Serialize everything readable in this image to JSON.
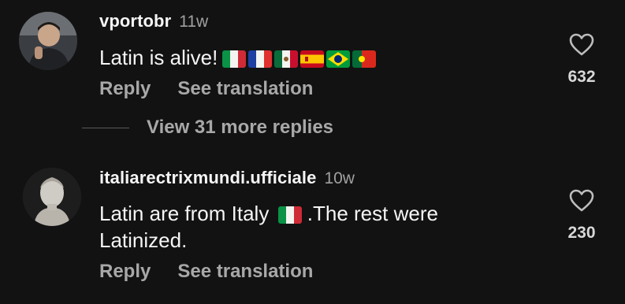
{
  "comments": [
    {
      "username": "vportobr",
      "age": "11w",
      "text": "Latin is alive!",
      "flags": [
        "flag-italy",
        "flag-france",
        "flag-mexico",
        "flag-spain",
        "flag-brazil",
        "flag-portugal"
      ],
      "reply_label": "Reply",
      "translate_label": "See translation",
      "likes": "632"
    },
    {
      "username": "italiarectrixmundi.ufficiale",
      "age": "10w",
      "text_before_flag": "Latin are from Italy",
      "flag": "flag-italy",
      "text_after_flag": " .The rest were",
      "text_line2": "Latinized.",
      "reply_label": "Reply",
      "translate_label": "See translation",
      "likes": "230"
    }
  ],
  "replies": {
    "label": "View 31 more replies"
  },
  "colors": {
    "background": "#121212",
    "text": "#f5f5f5",
    "muted": "#a8a8a8"
  }
}
